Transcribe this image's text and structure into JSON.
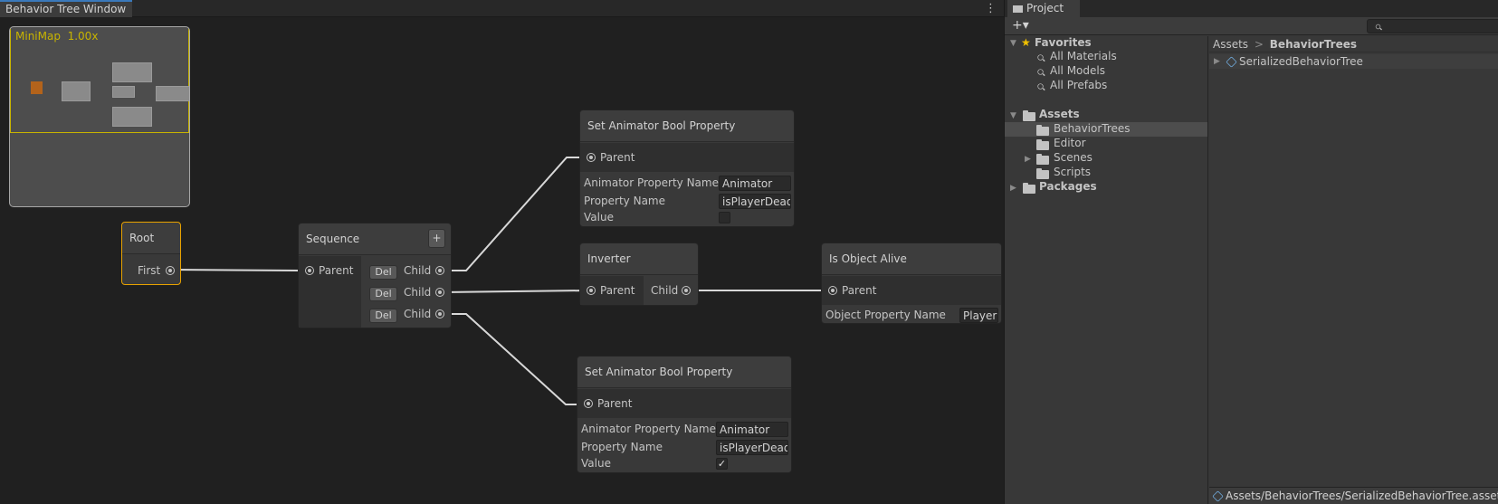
{
  "bt_window": {
    "tab_title": "Behavior Tree Window",
    "menu_glyph": "⋮",
    "minimap": {
      "label": "MiniMap",
      "zoom": "1.00x"
    }
  },
  "nodes": {
    "root": {
      "title": "Root",
      "port": "First"
    },
    "sequence": {
      "title": "Sequence",
      "add_label": "+",
      "parent": "Parent",
      "children": [
        {
          "del": "Del",
          "label": "Child"
        },
        {
          "del": "Del",
          "label": "Child"
        },
        {
          "del": "Del",
          "label": "Child"
        }
      ]
    },
    "set_bool_1": {
      "title": "Set Animator Bool Property",
      "parent": "Parent",
      "fields": [
        {
          "label": "Animator Property Name",
          "value": "Animator"
        },
        {
          "label": "Property Name",
          "value": "isPlayerDead"
        }
      ],
      "value_label": "Value",
      "value_checked": false
    },
    "inverter": {
      "title": "Inverter",
      "parent": "Parent",
      "child": "Child"
    },
    "is_object_alive": {
      "title": "Is Object Alive",
      "parent": "Parent",
      "field_label": "Object Property Name",
      "field_value": "Player"
    },
    "set_bool_2": {
      "title": "Set Animator Bool Property",
      "parent": "Parent",
      "fields": [
        {
          "label": "Animator Property Name",
          "value": "Animator"
        },
        {
          "label": "Property Name",
          "value": "isPlayerDead"
        }
      ],
      "value_label": "Value",
      "value_checked": true,
      "check_glyph": "✓"
    }
  },
  "project": {
    "tab_title": "Project",
    "add_label": "+▾",
    "favorites": {
      "label": "Favorites",
      "items": [
        "All Materials",
        "All Models",
        "All Prefabs"
      ]
    },
    "assets": {
      "label": "Assets",
      "items": [
        "BehaviorTrees",
        "Editor",
        "Scenes",
        "Scripts"
      ]
    },
    "packages": {
      "label": "Packages"
    },
    "breadcrumb": {
      "root": "Assets",
      "separator": ">",
      "current": "BehaviorTrees"
    },
    "content_items": [
      "SerializedBehaviorTree"
    ],
    "status_path": "Assets/BehaviorTrees/SerializedBehaviorTree.asset"
  },
  "colors": {
    "accent_tab": "#3a79bb",
    "root_outline": "#e8a200",
    "minimap_highlight": "#c8b400",
    "root_marker": "#b3631b"
  }
}
